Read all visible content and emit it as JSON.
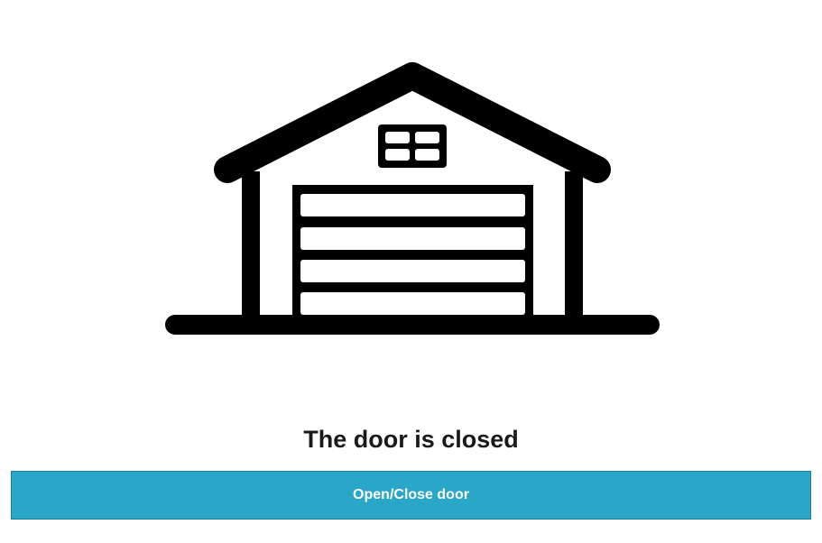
{
  "status": {
    "text": "The door is closed"
  },
  "action": {
    "button_label": "Open/Close door"
  },
  "garage": {
    "icon": "garage-closed-icon",
    "door_state": "closed"
  },
  "colors": {
    "button": "#2aa6c9",
    "text": "#1a1a1a",
    "icon": "#000000"
  }
}
